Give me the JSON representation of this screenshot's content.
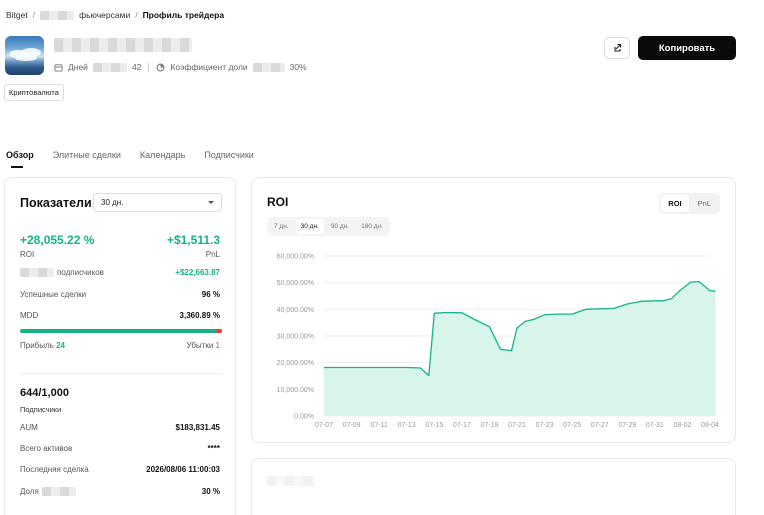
{
  "breadcrumb": {
    "root": "Bitget",
    "sep": "/",
    "middle_suffix": "фьючерсами",
    "current": "Профиль трейдера"
  },
  "profile": {
    "days_label": "Дней",
    "days_value": "42",
    "ratio_label": "Коэффициент доли",
    "ratio_value": "30%",
    "tag": "Криптовалюта"
  },
  "actions": {
    "copy_label": "Копировать",
    "share_icon": "share-icon"
  },
  "tabs": [
    {
      "label": "Обзор",
      "active": true
    },
    {
      "label": "Элитные сделки",
      "active": false
    },
    {
      "label": "Календарь",
      "active": false
    },
    {
      "label": "Подписчики",
      "active": false
    }
  ],
  "stats": {
    "title": "Показатели",
    "period": "30 дн.",
    "roi_value": "+28,055.22 %",
    "roi_label": "ROI",
    "pnl_value": "+$1,511.3",
    "pnl_label": "PnL",
    "subscribers_label": "подписчиков",
    "subscribers_value": "+$22,663.87",
    "winrate_label": "Успешные сделки",
    "winrate_value": "96 %",
    "mdd_label": "MDD",
    "mdd_value": "3,360.89 %",
    "win_ratio": 0.96,
    "profit_label": "Прибыль",
    "profit_count": "24",
    "loss_label": "Убытки",
    "loss_count": "1",
    "followers_value": "644/1,000",
    "followers_label": "Подписчики",
    "aum_label": "AUM",
    "aum_value": "$183,831.45",
    "assets_label": "Всего активов",
    "assets_value": "****",
    "last_trade_label": "Последняя сделка",
    "last_trade_value": "2026/08/06 11:00:03",
    "share_label": "Доля",
    "share_value": "30 %"
  },
  "roi_panel": {
    "title": "ROI",
    "toggle": [
      "ROI",
      "PnL"
    ],
    "toggle_active": "ROI",
    "periods": [
      "7 дн.",
      "30 дн.",
      "90 дн.",
      "180 дн."
    ],
    "period_active": "30 дн."
  },
  "colors": {
    "accent": "#16b38b",
    "fill": "#d8f5ec",
    "loss": "#ef3d3d",
    "button": "#0b0b0b"
  },
  "chart_data": {
    "type": "area",
    "title": "",
    "xlabel": "",
    "ylabel": "",
    "ylim": [
      0,
      60000
    ],
    "yticks": [
      "0.00%",
      "10,000.00%",
      "20,000.00%",
      "30,000.00%",
      "40,000.00%",
      "50,000.00%",
      "60,000.00%"
    ],
    "x_ticks": [
      "07-07",
      "07-09",
      "07-11",
      "07-13",
      "07-15",
      "07-17",
      "07-19",
      "07-21",
      "07-23",
      "07-25",
      "07-27",
      "07-29",
      "07-31",
      "08-02",
      "08-04"
    ],
    "x": [
      0,
      1,
      2,
      3,
      3.5,
      3.8,
      4,
      4.4,
      5,
      5.5,
      6,
      6.4,
      6.8,
      7,
      7.3,
      7.6,
      8,
      8.5,
      9,
      9.5,
      10,
      10.5,
      11,
      11.5,
      12,
      12.3,
      12.6,
      12.9,
      13.3,
      13.6,
      14,
      14.2
    ],
    "series": [
      {
        "values": [
          18200,
          18200,
          18200,
          18200,
          18000,
          15200,
          38500,
          38800,
          38700,
          36000,
          33500,
          25000,
          24500,
          33000,
          35500,
          36200,
          38000,
          38200,
          38200,
          40000,
          40200,
          40300,
          42000,
          43000,
          43200,
          43200,
          44000,
          47000,
          50200,
          50400,
          47000,
          46800
        ]
      }
    ],
    "grid": true
  }
}
